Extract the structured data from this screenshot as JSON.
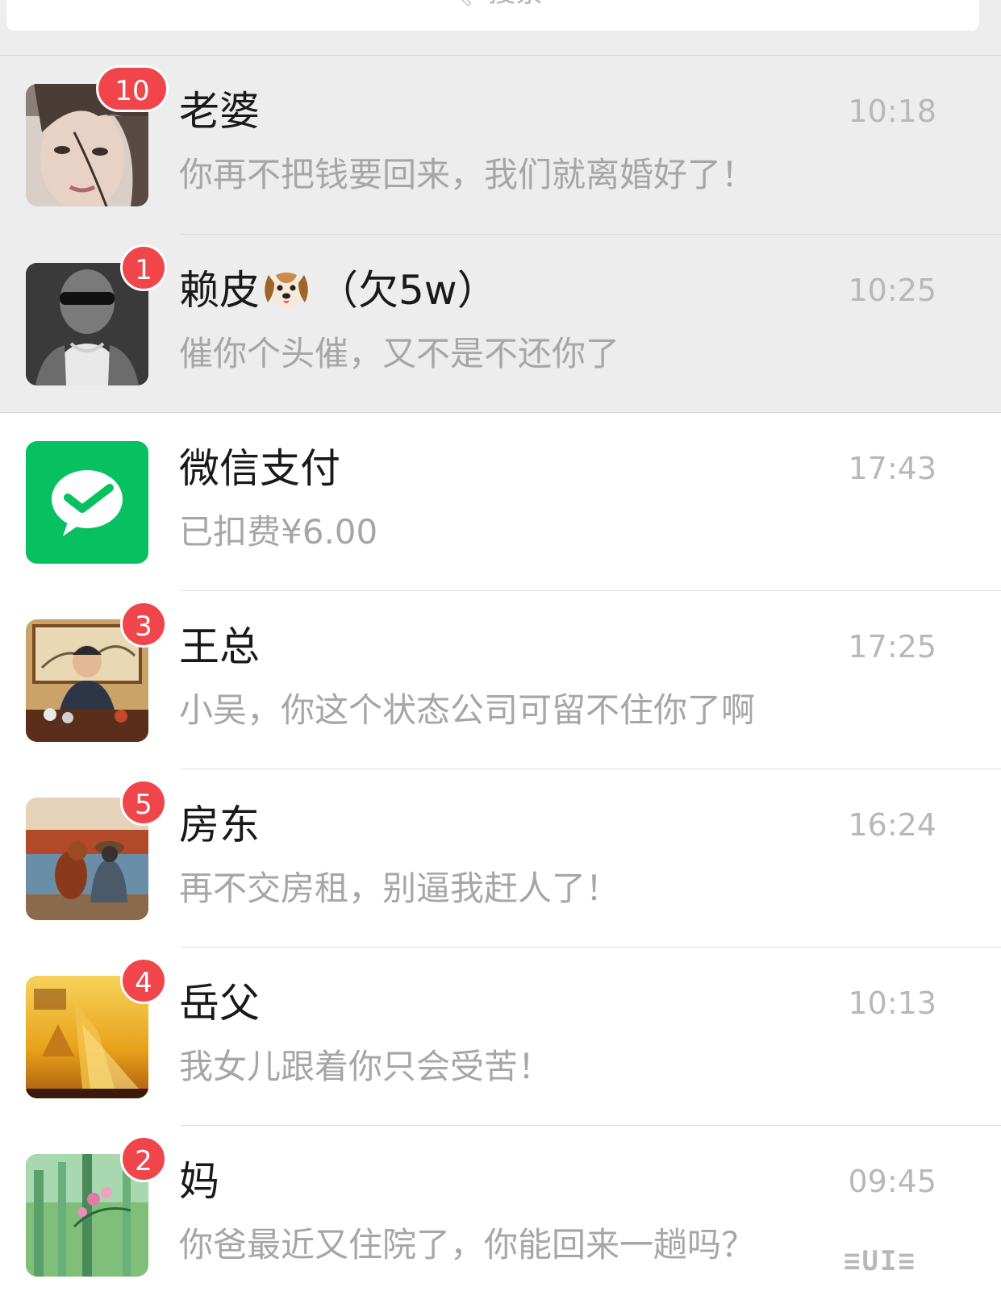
{
  "search": {
    "label": "搜索",
    "icon": "search-icon"
  },
  "colors": {
    "badge": "#f0464b",
    "wechat_pay_green": "#07c160",
    "pinned_bg": "#ededed",
    "normal_bg": "#ffffff"
  },
  "chats": [
    {
      "name": "老婆",
      "time": "10:18",
      "message": "你再不把钱要回来，我们就离婚好了！",
      "unread": "10",
      "pinned": true
    },
    {
      "name": "赖皮",
      "name_suffix": "（欠5w）",
      "name_emoji": "dog-face-emoji",
      "time": "10:25",
      "message": "催你个头催，又不是不还你了",
      "unread": "1",
      "pinned": true
    },
    {
      "name": "微信支付",
      "time": "17:43",
      "message": "已扣费¥6.00",
      "pinned": false
    },
    {
      "name": "王总",
      "time": "17:25",
      "message": "小吴，你这个状态公司可留不住你了啊",
      "unread": "3",
      "pinned": false
    },
    {
      "name": "房东",
      "time": "16:24",
      "message": "再不交房租，别逼我赶人了！",
      "unread": "5",
      "pinned": false
    },
    {
      "name": "岳父",
      "time": "10:13",
      "message": "我女儿跟着你只会受苦！",
      "unread": "4",
      "pinned": false
    },
    {
      "name": "妈",
      "time": "09:45",
      "message": "你爸最近又住院了，你能回来一趟吗？",
      "unread": "2",
      "pinned": false
    }
  ],
  "watermark": "≡UI≡"
}
